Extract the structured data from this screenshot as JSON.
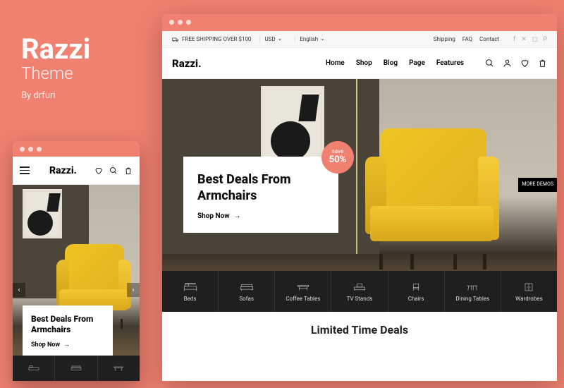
{
  "promo": {
    "title": "Razzi",
    "subtitle": "Theme",
    "author": "By drfuri"
  },
  "topbar": {
    "shipping_label": "FREE SHIPPING OVER $100",
    "currency": "USD",
    "language": "English",
    "links": [
      "Shipping",
      "FAQ",
      "Contact"
    ]
  },
  "brand": "Razzi.",
  "nav": {
    "items": [
      "Home",
      "Shop",
      "Blog",
      "Page",
      "Features"
    ]
  },
  "hero": {
    "badge_label": "save",
    "badge_pct": "50%",
    "title": "Best Deals From Armchairs",
    "cta": "Shop Now"
  },
  "categories": [
    "Beds",
    "Sofas",
    "Coffee Tables",
    "TV Stands",
    "Chairs",
    "Dining Tables",
    "Wardrobes"
  ],
  "more_demos": "MORE DEMOS",
  "section_title": "Limited Time Deals",
  "mobile": {
    "brand": "Razzi.",
    "hero_title": "Best Deals From Armchairs",
    "cta": "Shop Now"
  },
  "colors": {
    "accent": "#f08070",
    "chair": "#f0c423",
    "dark": "#1f1f1f"
  }
}
